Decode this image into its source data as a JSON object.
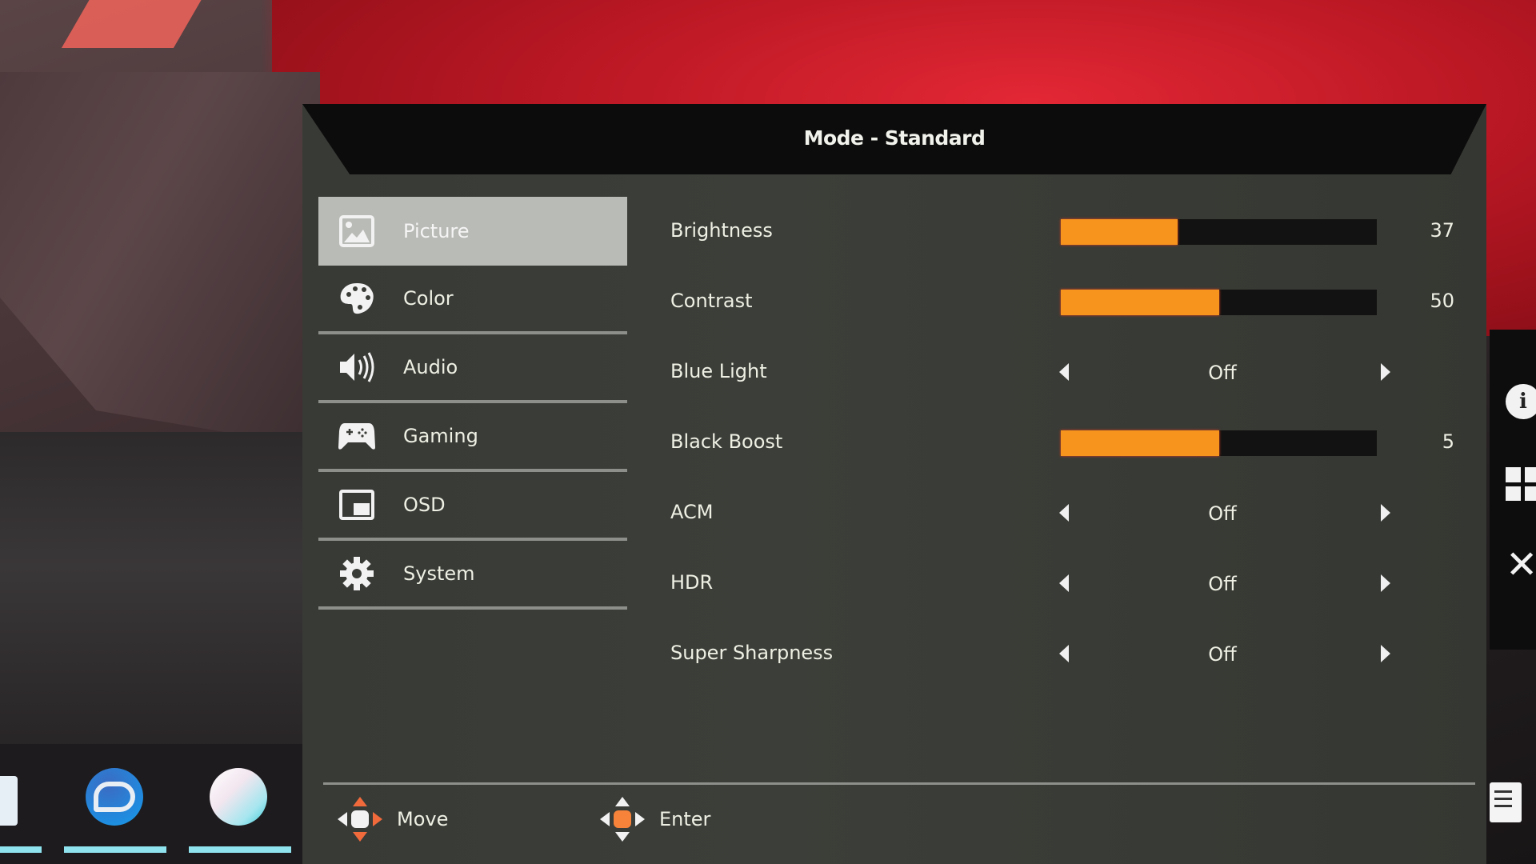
{
  "osd": {
    "title": "Mode - Standard",
    "menu": [
      {
        "label": "Picture",
        "icon": "picture-icon",
        "active": true
      },
      {
        "label": "Color",
        "icon": "palette-icon",
        "active": false
      },
      {
        "label": "Audio",
        "icon": "speaker-icon",
        "active": false
      },
      {
        "label": "Gaming",
        "icon": "gamepad-icon",
        "active": false
      },
      {
        "label": "OSD",
        "icon": "osd-window-icon",
        "active": false
      },
      {
        "label": "System",
        "icon": "gear-icon",
        "active": false
      }
    ],
    "settings": [
      {
        "label": "Brightness",
        "type": "slider",
        "value": 37,
        "display": "37",
        "fill_fraction": 0.37
      },
      {
        "label": "Contrast",
        "type": "slider",
        "value": 50,
        "display": "50",
        "fill_fraction": 0.5
      },
      {
        "label": "Blue Light",
        "type": "option",
        "display": "Off"
      },
      {
        "label": "Black Boost",
        "type": "slider",
        "value": 5,
        "display": "5",
        "fill_fraction": 0.5
      },
      {
        "label": "ACM",
        "type": "option",
        "display": "Off"
      },
      {
        "label": "HDR",
        "type": "option",
        "display": "Off"
      },
      {
        "label": "Super Sharpness",
        "type": "option",
        "display": "Off"
      }
    ],
    "footer": {
      "move_label": "Move",
      "enter_label": "Enter"
    },
    "colors": {
      "accent": "#f7941e",
      "slider_track": "#121212",
      "menu_active_bg": "#b9bbb6"
    }
  },
  "side_strip": {
    "icons": [
      "info-icon",
      "grid-icon",
      "close-icon"
    ]
  },
  "taskbar": {
    "icons": [
      "file-icon",
      "steam-icon",
      "app-orb-icon"
    ]
  }
}
